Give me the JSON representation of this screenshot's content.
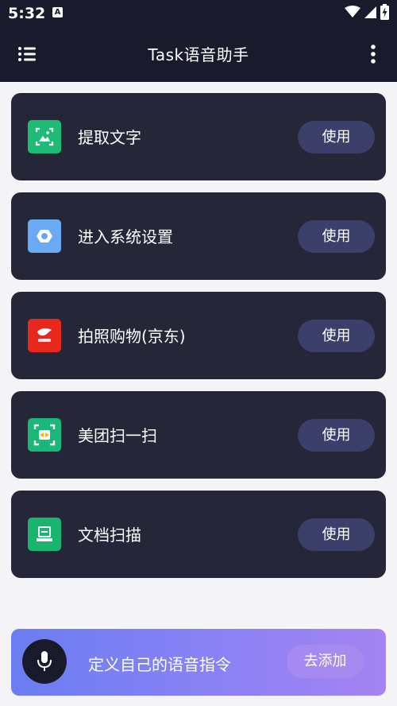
{
  "status_bar": {
    "time": "5:32",
    "notification_letter": "A"
  },
  "app_bar": {
    "title": "Task语音助手"
  },
  "commands": [
    {
      "label": "提取文字",
      "button": "使用",
      "icon": "image-text-scan-icon",
      "icon_color": "#1dbb75"
    },
    {
      "label": "进入系统设置",
      "button": "使用",
      "icon": "settings-gear-icon",
      "icon_color": "#6aaaf4"
    },
    {
      "label": "拍照购物(京东)",
      "button": "使用",
      "icon": "jd-app-icon",
      "icon_color": "#e8281e"
    },
    {
      "label": "美团扫一扫",
      "button": "使用",
      "icon": "meituan-scan-icon",
      "icon_color": "#19b778"
    },
    {
      "label": "文档扫描",
      "button": "使用",
      "icon": "document-scan-icon",
      "icon_color": "#19b46e"
    }
  ],
  "bottom_bar": {
    "label": "定义自己的语音指令",
    "add_button": "去添加",
    "mic_icon": "microphone-icon"
  },
  "colors": {
    "header_bg": "#191a2b",
    "card_bg": "#252638",
    "button_bg": "#3c3f6a",
    "page_bg": "#f4f4f6"
  }
}
